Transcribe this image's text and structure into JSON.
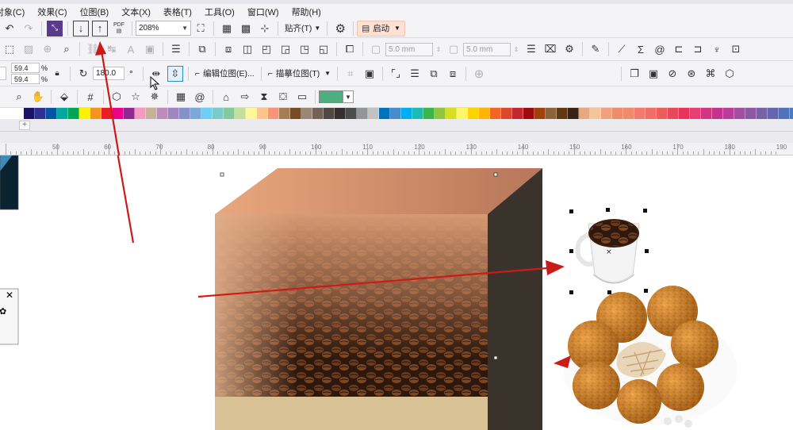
{
  "menus": [
    "对象(C)",
    "效果(C)",
    "位图(B)",
    "文本(X)",
    "表格(T)",
    "工具(O)",
    "窗口(W)",
    "帮助(H)"
  ],
  "toolbar": {
    "zoom_value": "208%",
    "snap_label": "贴齐(T)",
    "launch_label": "启动",
    "pdf_label": "PDF"
  },
  "property_bar": {
    "outline_width_1": "5.0 mm",
    "outline_width_2": "5.0 mm",
    "scale_w": "59.4",
    "scale_h": "59.4",
    "percent_1": "%",
    "percent_2": "%",
    "rotation": "180.0",
    "degree": "°",
    "edit_bitmap_label": "编辑位图(E)...",
    "trace_bitmap_label": "描摹位图(T)"
  },
  "ruler": {
    "labels": [
      "50",
      "60",
      "70",
      "80",
      "90",
      "100",
      "110",
      "120",
      "130",
      "140",
      "150",
      "160",
      "170",
      "180",
      "190"
    ]
  },
  "palette_colors": [
    "#1b1464",
    "#2e3192",
    "#0054a6",
    "#00a99d",
    "#00a651",
    "#fff200",
    "#f7941d",
    "#ed1c24",
    "#ec008c",
    "#92278f",
    "#f49ac1",
    "#c7b299",
    "#bd8cbf",
    "#a186be",
    "#8393ca",
    "#7da7d9",
    "#6dcff6",
    "#7accc8",
    "#82ca9c",
    "#c4df9b",
    "#fff799",
    "#fdc689",
    "#f69679",
    "#a67c52",
    "#754c24",
    "#998675",
    "#736357",
    "#534741",
    "#362f2d",
    "#4c4c4c",
    "#939598",
    "#c2c2c2",
    "#0072bc",
    "#448ccb",
    "#00aeef",
    "#1cbbb4",
    "#39b54a",
    "#8dc63f",
    "#d7df23",
    "#fff568",
    "#ffd200",
    "#ffb400",
    "#f26522",
    "#e0462b",
    "#c1272d",
    "#9e0b0f",
    "#a0410d",
    "#8c6239",
    "#603913",
    "#3b2314",
    "#e3aa80",
    "#f5c49a",
    "#f0a07d",
    "#e88e6b",
    "#ef8b6b",
    "#f37a6c",
    "#f06e65",
    "#ed5e5b",
    "#e7495a",
    "#e8345a",
    "#ea3d75",
    "#d23682",
    "#c3328d",
    "#b93d98",
    "#a44ea0",
    "#8e59a4",
    "#7a60a8",
    "#6566ad",
    "#5272b8",
    "#447ec0"
  ],
  "colors": {
    "fill_swatch": "#4caf7d",
    "arrow": "#cc1a1a",
    "box_top": "#d9906a",
    "box_side": "#3a332b",
    "box_bottom": "#d8c195"
  }
}
